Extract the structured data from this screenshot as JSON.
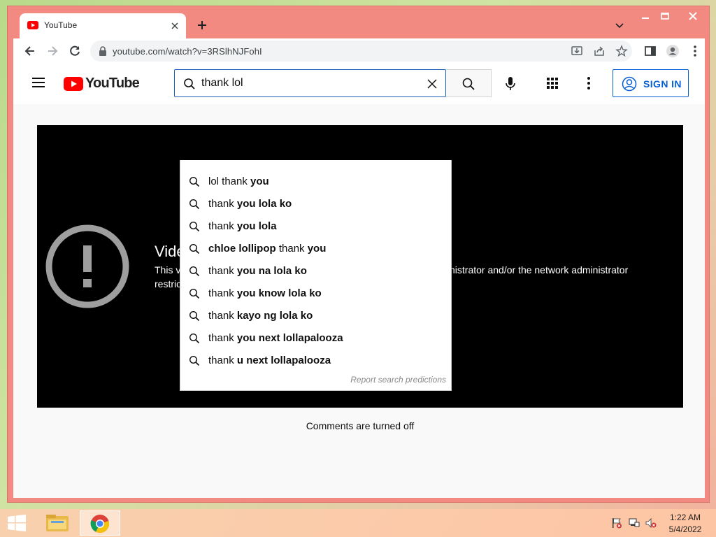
{
  "browser": {
    "tab_title": "YouTube",
    "url": "youtube.com/watch?v=3RSlhNJFohI"
  },
  "youtube": {
    "logo_text": "YouTube",
    "search_value": "thank lol",
    "sign_in_label": "SIGN IN",
    "comments_status": "Comments are turned off"
  },
  "player_error": {
    "title": "Vide",
    "line1": "This v",
    "line2": "restric",
    "line1_tail": "nistrator and/or the network administrator"
  },
  "suggestions": [
    {
      "parts": [
        {
          "t": "lol thank ",
          "b": false
        },
        {
          "t": "you",
          "b": true
        }
      ]
    },
    {
      "parts": [
        {
          "t": "thank ",
          "b": false
        },
        {
          "t": "you lola ko",
          "b": true
        }
      ]
    },
    {
      "parts": [
        {
          "t": "thank ",
          "b": false
        },
        {
          "t": "you lola",
          "b": true
        }
      ]
    },
    {
      "parts": [
        {
          "t": "chloe lollipop",
          "b": true
        },
        {
          "t": " thank ",
          "b": false
        },
        {
          "t": "you",
          "b": true
        }
      ]
    },
    {
      "parts": [
        {
          "t": "thank ",
          "b": false
        },
        {
          "t": "you na lola ko",
          "b": true
        }
      ]
    },
    {
      "parts": [
        {
          "t": "thank ",
          "b": false
        },
        {
          "t": "you know lola ko",
          "b": true
        }
      ]
    },
    {
      "parts": [
        {
          "t": "thank ",
          "b": false
        },
        {
          "t": "kayo ng lola ko",
          "b": true
        }
      ]
    },
    {
      "parts": [
        {
          "t": "thank ",
          "b": false
        },
        {
          "t": "you next lollapalooza",
          "b": true
        }
      ]
    },
    {
      "parts": [
        {
          "t": "thank ",
          "b": false
        },
        {
          "t": "u next lollapalooza",
          "b": true
        }
      ]
    }
  ],
  "report_link": "Report search predictions",
  "taskbar": {
    "time": "1:22 AM",
    "date": "5/4/2022"
  },
  "colors": {
    "window_frame": "#f28a82",
    "youtube_red": "#ff0000",
    "link_blue": "#065fd4",
    "search_focus_blue": "#1c62b9"
  },
  "icons": [
    "youtube-favicon",
    "close-icon",
    "plus-icon",
    "chevron-down-icon",
    "minimize-icon",
    "maximize-icon",
    "back-arrow-icon",
    "forward-arrow-icon",
    "reload-icon",
    "lock-icon",
    "install-icon",
    "share-icon",
    "star-icon",
    "side-panel-icon",
    "profile-icon",
    "kebab-menu-icon",
    "hamburger-menu-icon",
    "search-icon",
    "mic-icon",
    "apps-grid-icon",
    "account-circle-icon",
    "error-exclamation-icon",
    "windows-start-icon",
    "file-explorer-icon",
    "chrome-icon",
    "flag-icon",
    "network-icon",
    "volume-muted-icon"
  ]
}
